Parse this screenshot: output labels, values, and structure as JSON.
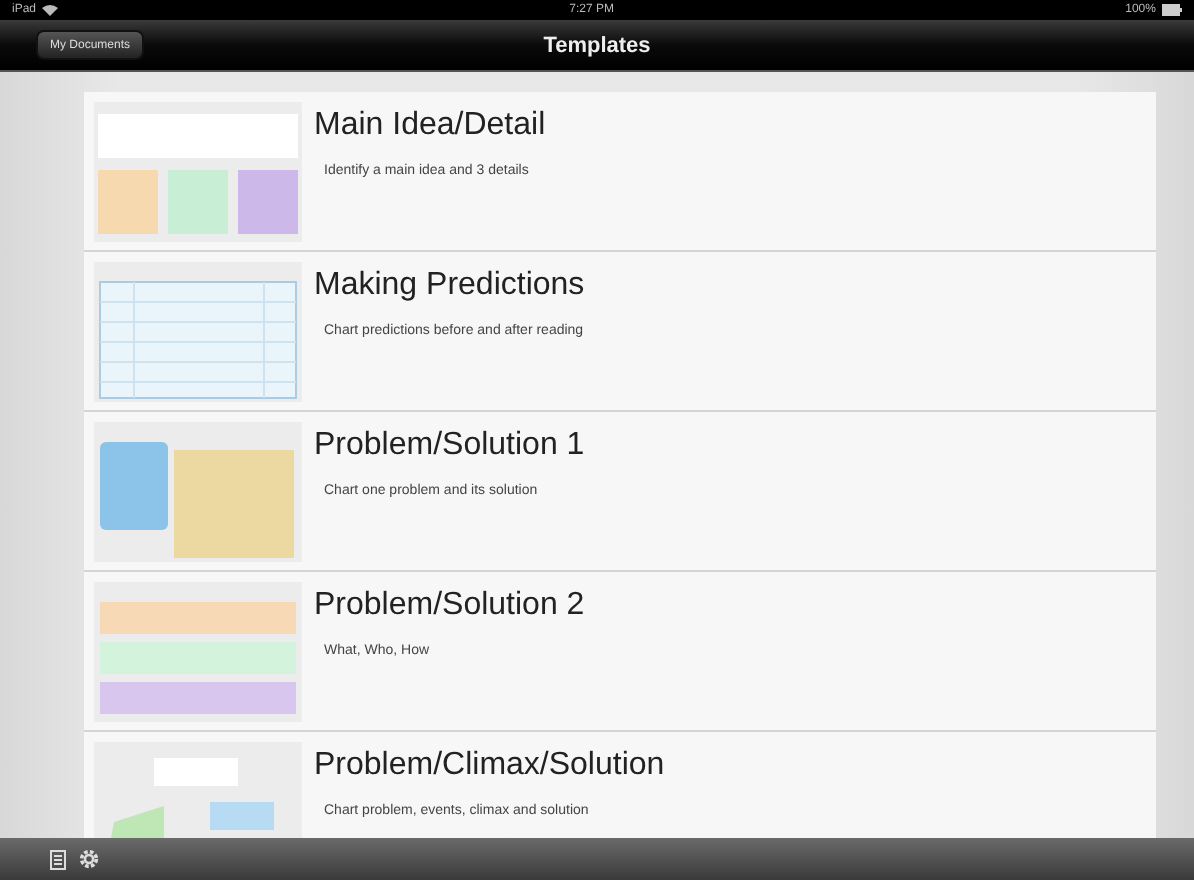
{
  "status_bar": {
    "device": "iPad",
    "time": "7:27 PM",
    "battery": "100%"
  },
  "nav_bar": {
    "back_button": "My Documents",
    "title": "Templates"
  },
  "templates": [
    {
      "title": "Main Idea/Detail",
      "description": "Identify a main idea and 3 details",
      "kind": "three-boxes"
    },
    {
      "title": "Making Predictions",
      "description": "Chart predictions before and after reading",
      "kind": "table"
    },
    {
      "title": "Problem/Solution 1",
      "description": "Chart one problem and its solution",
      "kind": "two-boxes"
    },
    {
      "title": "Problem/Solution 2",
      "description": "What, Who, How",
      "kind": "stacked"
    },
    {
      "title": "Problem/Climax/Solution",
      "description": "Chart problem, events, climax and solution",
      "kind": "diagram"
    }
  ]
}
